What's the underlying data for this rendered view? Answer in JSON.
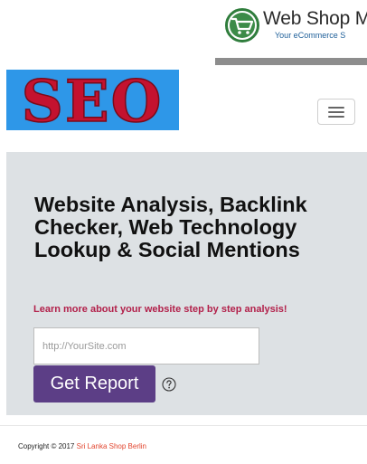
{
  "header": {
    "brand_name": "Web Shop M",
    "brand_tagline": "Your eCommerce S",
    "banner_text": "SEO",
    "colors": {
      "banner_bg": "#2e97e8",
      "banner_text": "#c4122f",
      "logo_ring": "#2f7d3c"
    }
  },
  "navbar": {
    "toggle_icon": "hamburger-menu-icon"
  },
  "hero": {
    "title": "Website Analysis, Backlink Checker, Web Technology Lookup & Social Mentions",
    "subtitle": "Learn more about your website step by step analysis!",
    "url_input": {
      "value": "",
      "placeholder": "http://YourSite.com"
    },
    "submit_label": "Get Report",
    "help_icon": "question-circle-icon",
    "colors": {
      "background": "#dde1e4",
      "subtitle": "#b2204a",
      "button": "#5c3e86"
    }
  },
  "footer": {
    "copyright_prefix": "Copyright © 2017 ",
    "copyright_link": "Sri Lanka Shop Berlin",
    "link_color": "#e2452e"
  }
}
